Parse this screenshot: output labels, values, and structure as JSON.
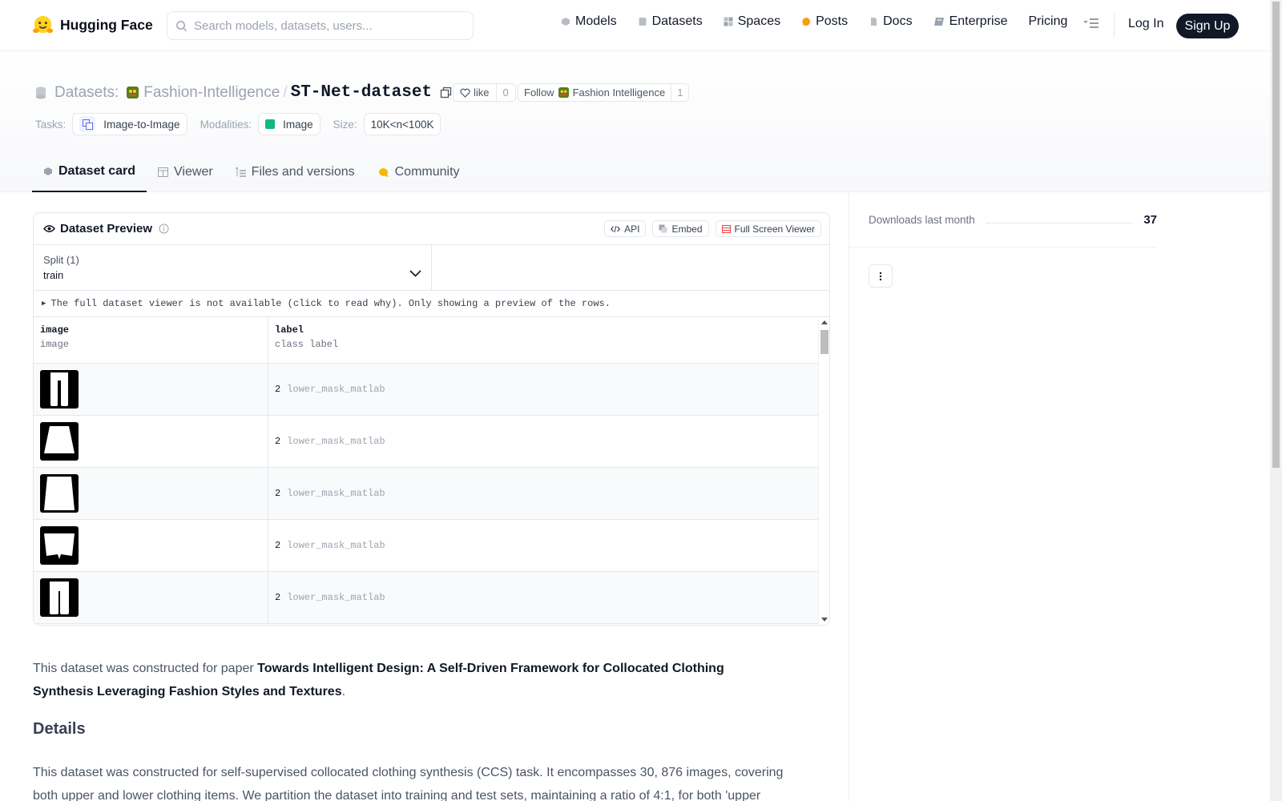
{
  "nav": {
    "brand": "Hugging Face",
    "search_placeholder": "Search models, datasets, users...",
    "links": [
      {
        "label": "Models",
        "icon": "models-icon",
        "color": "#b9bdc6"
      },
      {
        "label": "Datasets",
        "icon": "datasets-icon",
        "color": "#b9bdc6"
      },
      {
        "label": "Spaces",
        "icon": "spaces-icon",
        "color": "#b9bdc6"
      },
      {
        "label": "Posts",
        "icon": "posts-icon",
        "color": "#f59e0b"
      },
      {
        "label": "Docs",
        "icon": "docs-icon",
        "color": "#b9bdc6"
      },
      {
        "label": "Enterprise",
        "icon": "enterprise-icon",
        "color": "#9ca3af"
      },
      {
        "label": "Pricing",
        "icon": "",
        "color": ""
      }
    ],
    "login": "Log In",
    "signup": "Sign Up"
  },
  "header": {
    "section": "Datasets:",
    "org": "Fashion-Intelligence",
    "repo": "ST-Net-dataset",
    "like_label": "like",
    "like_count": "0",
    "follow_label": "Follow",
    "follow_org": "Fashion Intelligence",
    "follow_count": "1",
    "tasks_label": "Tasks:",
    "task": "Image-to-Image",
    "modalities_label": "Modalities:",
    "modality": "Image",
    "size_label": "Size:",
    "size": "10K<n<100K"
  },
  "tabs": [
    {
      "label": "Dataset card",
      "active": true
    },
    {
      "label": "Viewer",
      "active": false
    },
    {
      "label": "Files and versions",
      "active": false
    },
    {
      "label": "Community",
      "active": false
    }
  ],
  "preview": {
    "title": "Dataset Preview",
    "api": "API",
    "embed": "Embed",
    "fullscreen": "Full Screen Viewer",
    "split_label": "Split (1)",
    "split_value": "train",
    "notice": "The full dataset viewer is not available (click to read why). Only showing a preview of the rows.",
    "columns": [
      {
        "name": "image",
        "type": "image"
      },
      {
        "name": "label",
        "type": "class label"
      }
    ],
    "rows": [
      {
        "label_id": "2",
        "label_name": "lower_mask_matlab",
        "shape": "pants"
      },
      {
        "label_id": "2",
        "label_name": "lower_mask_matlab",
        "shape": "skirt"
      },
      {
        "label_id": "2",
        "label_name": "lower_mask_matlab",
        "shape": "skirt-long"
      },
      {
        "label_id": "2",
        "label_name": "lower_mask_matlab",
        "shape": "shorts"
      },
      {
        "label_id": "2",
        "label_name": "lower_mask_matlab",
        "shape": "pants-wide"
      }
    ]
  },
  "card": {
    "intro_prefix": "This dataset was constructed for paper ",
    "paper_title": "Towards Intelligent Design: A Self-Driven Framework for Collocated Clothing Synthesis Leveraging Fashion Styles and Textures",
    "intro_suffix": ".",
    "details_heading": "Details",
    "details_text": "This dataset was constructed for self-supervised collocated clothing synthesis (CCS) task. It encompasses 30, 876 images, covering both upper and lower clothing items. We partition the dataset into training and test sets, maintaining a ratio of 4:1, for both 'upper"
  },
  "sidebar": {
    "downloads_label": "Downloads last month",
    "downloads_value": "37"
  }
}
